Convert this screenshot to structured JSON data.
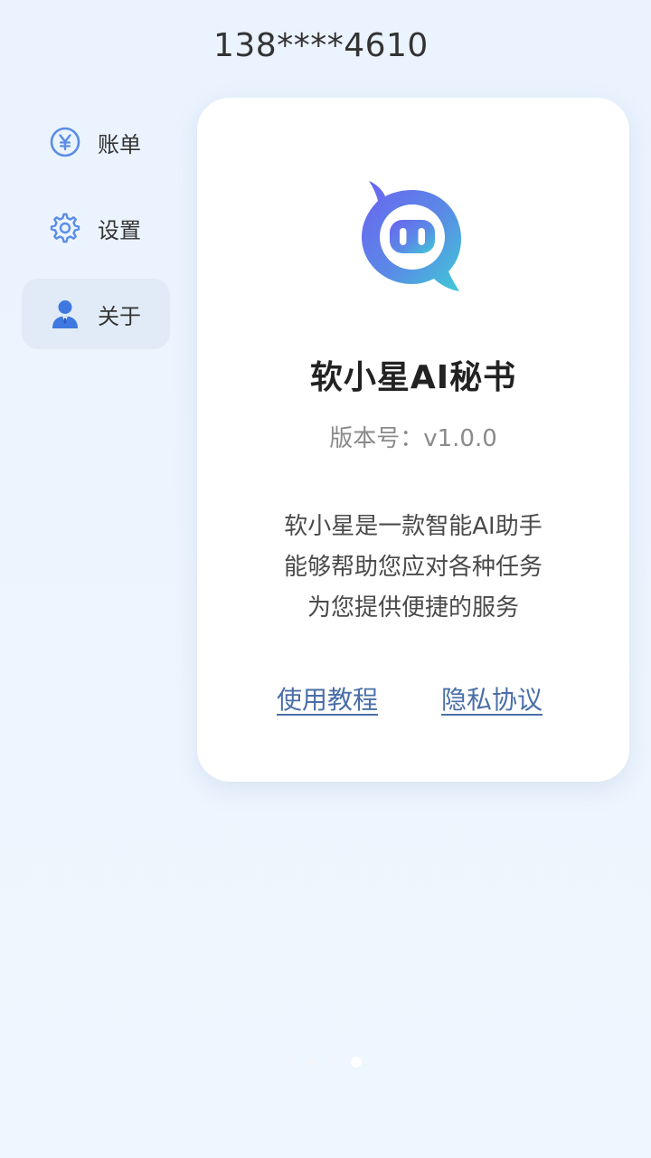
{
  "user": {
    "phone": "138****4610"
  },
  "menu": {
    "items": [
      {
        "label": "账单",
        "icon": "yen-icon",
        "active": false
      },
      {
        "label": "设置",
        "icon": "gear-icon",
        "active": false
      },
      {
        "label": "关于",
        "icon": "user-icon",
        "active": true
      }
    ]
  },
  "about": {
    "app_name": "软小星AI秘书",
    "version_label": "版本号：v1.0.0",
    "description": [
      "软小星是一款智能AI助手",
      "能够帮助您应对各种任务",
      "为您提供便捷的服务"
    ],
    "links": {
      "tutorial": "使用教程",
      "privacy": "隐私协议"
    }
  },
  "pager": {
    "count": 4,
    "active_index": 3
  },
  "colors": {
    "background": "#eaf3fd",
    "accent": "#5b8de8",
    "link": "#4a6fa8",
    "active_menu_bg": "#e1ebf7",
    "logo_gradient": [
      "#6b6cf0",
      "#3fc6d6"
    ]
  }
}
